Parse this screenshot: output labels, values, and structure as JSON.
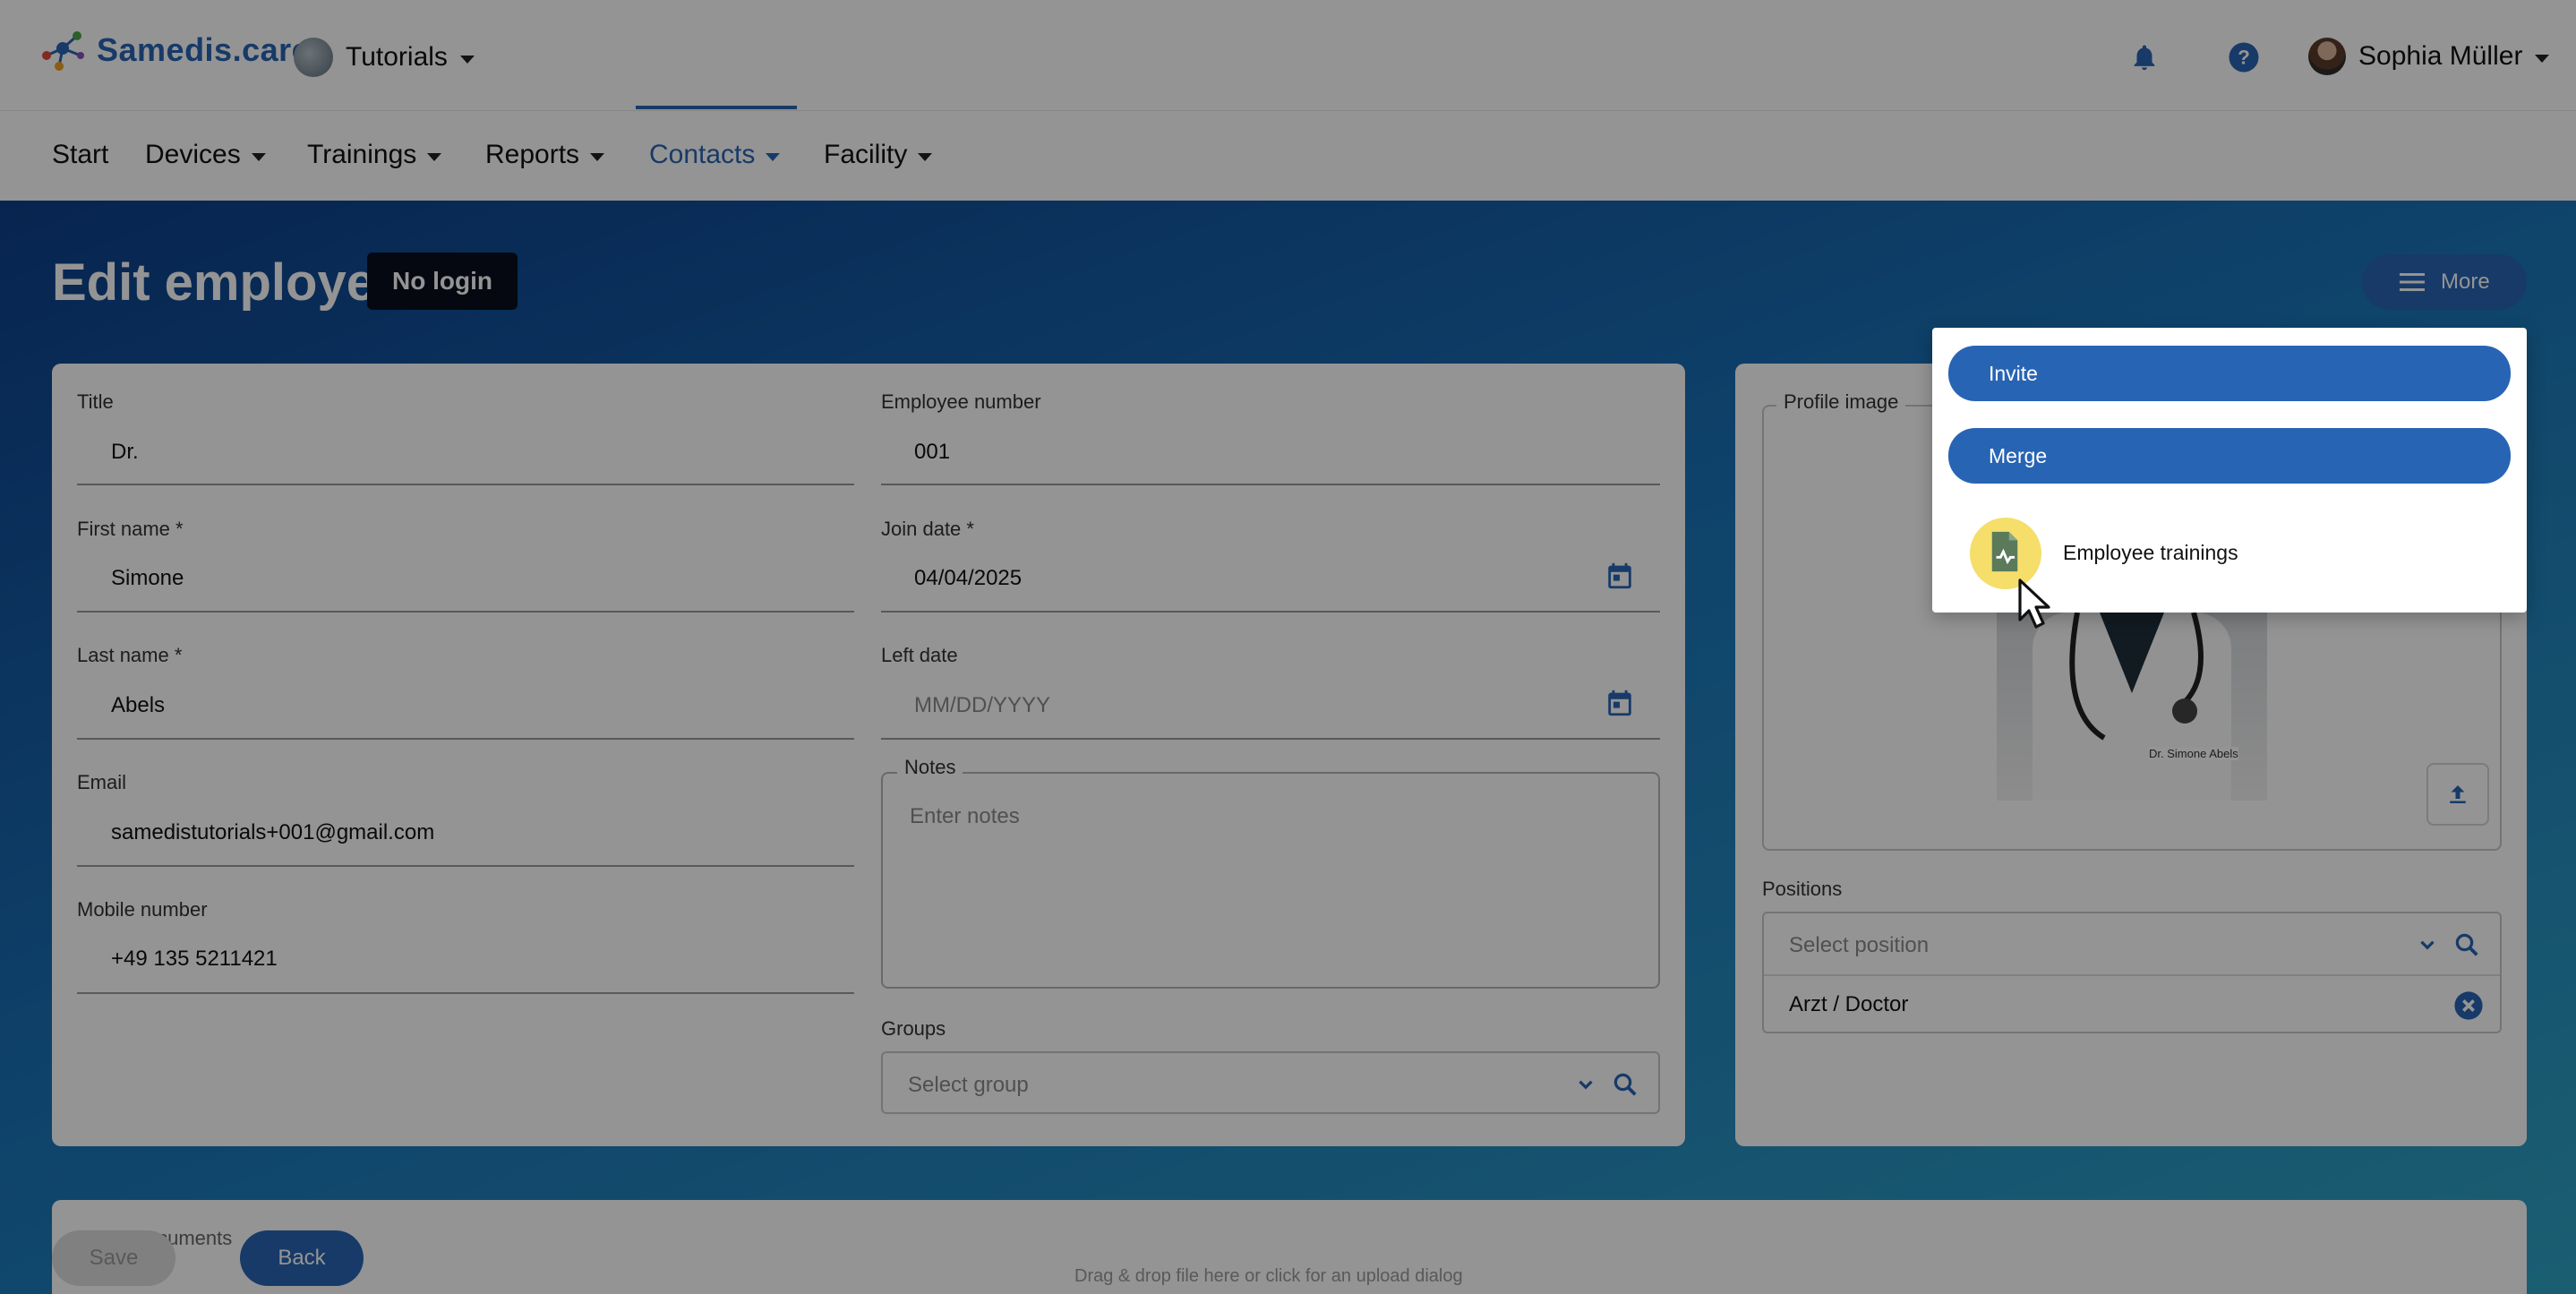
{
  "header": {
    "brand": "Samedis.care",
    "tenant": "Tutorials",
    "user": "Sophia Müller",
    "icons": {
      "notifications": "bell-icon",
      "help": "help-icon",
      "avatar": "avatar"
    }
  },
  "nav": {
    "items": [
      {
        "label": "Start"
      },
      {
        "label": "Devices"
      },
      {
        "label": "Trainings"
      },
      {
        "label": "Reports"
      },
      {
        "label": "Contacts"
      },
      {
        "label": "Facility"
      }
    ],
    "active": "Contacts"
  },
  "page": {
    "title": "Edit employee",
    "badge": "No login",
    "more_label": "More"
  },
  "form": {
    "title": {
      "label": "Title",
      "value": "Dr."
    },
    "employee_number": {
      "label": "Employee number",
      "value": "001"
    },
    "first_name": {
      "label": "First name *",
      "value": "Simone"
    },
    "join_date": {
      "label": "Join date *",
      "value": "04/04/2025"
    },
    "last_name": {
      "label": "Last name *",
      "value": "Abels"
    },
    "left_date": {
      "label": "Left date",
      "placeholder": "MM/DD/YYYY"
    },
    "email": {
      "label": "Email",
      "value": "samedistutorials+001@gmail.com"
    },
    "notes": {
      "label": "Notes",
      "placeholder": "Enter notes"
    },
    "mobile": {
      "label": "Mobile number",
      "value": "+49 135 5211421"
    },
    "groups": {
      "label": "Groups",
      "placeholder": "Select group"
    }
  },
  "profile": {
    "image_label": "Profile image",
    "coat_text": "Dr. Simone Abels",
    "positions_label": "Positions",
    "positions_placeholder": "Select position",
    "positions": [
      "Arzt / Doctor"
    ]
  },
  "dropdown": {
    "invite": "Invite",
    "merge": "Merge",
    "employee_trainings": "Employee trainings"
  },
  "documents": {
    "label": "Documents",
    "hint": "Drag & drop file here or click for an upload dialog"
  },
  "footer": {
    "save": "Save",
    "back": "Back"
  },
  "colors": {
    "primary": "#2864b4",
    "badge_bg": "#0a0f1e",
    "highlight": "#f5de6a"
  }
}
